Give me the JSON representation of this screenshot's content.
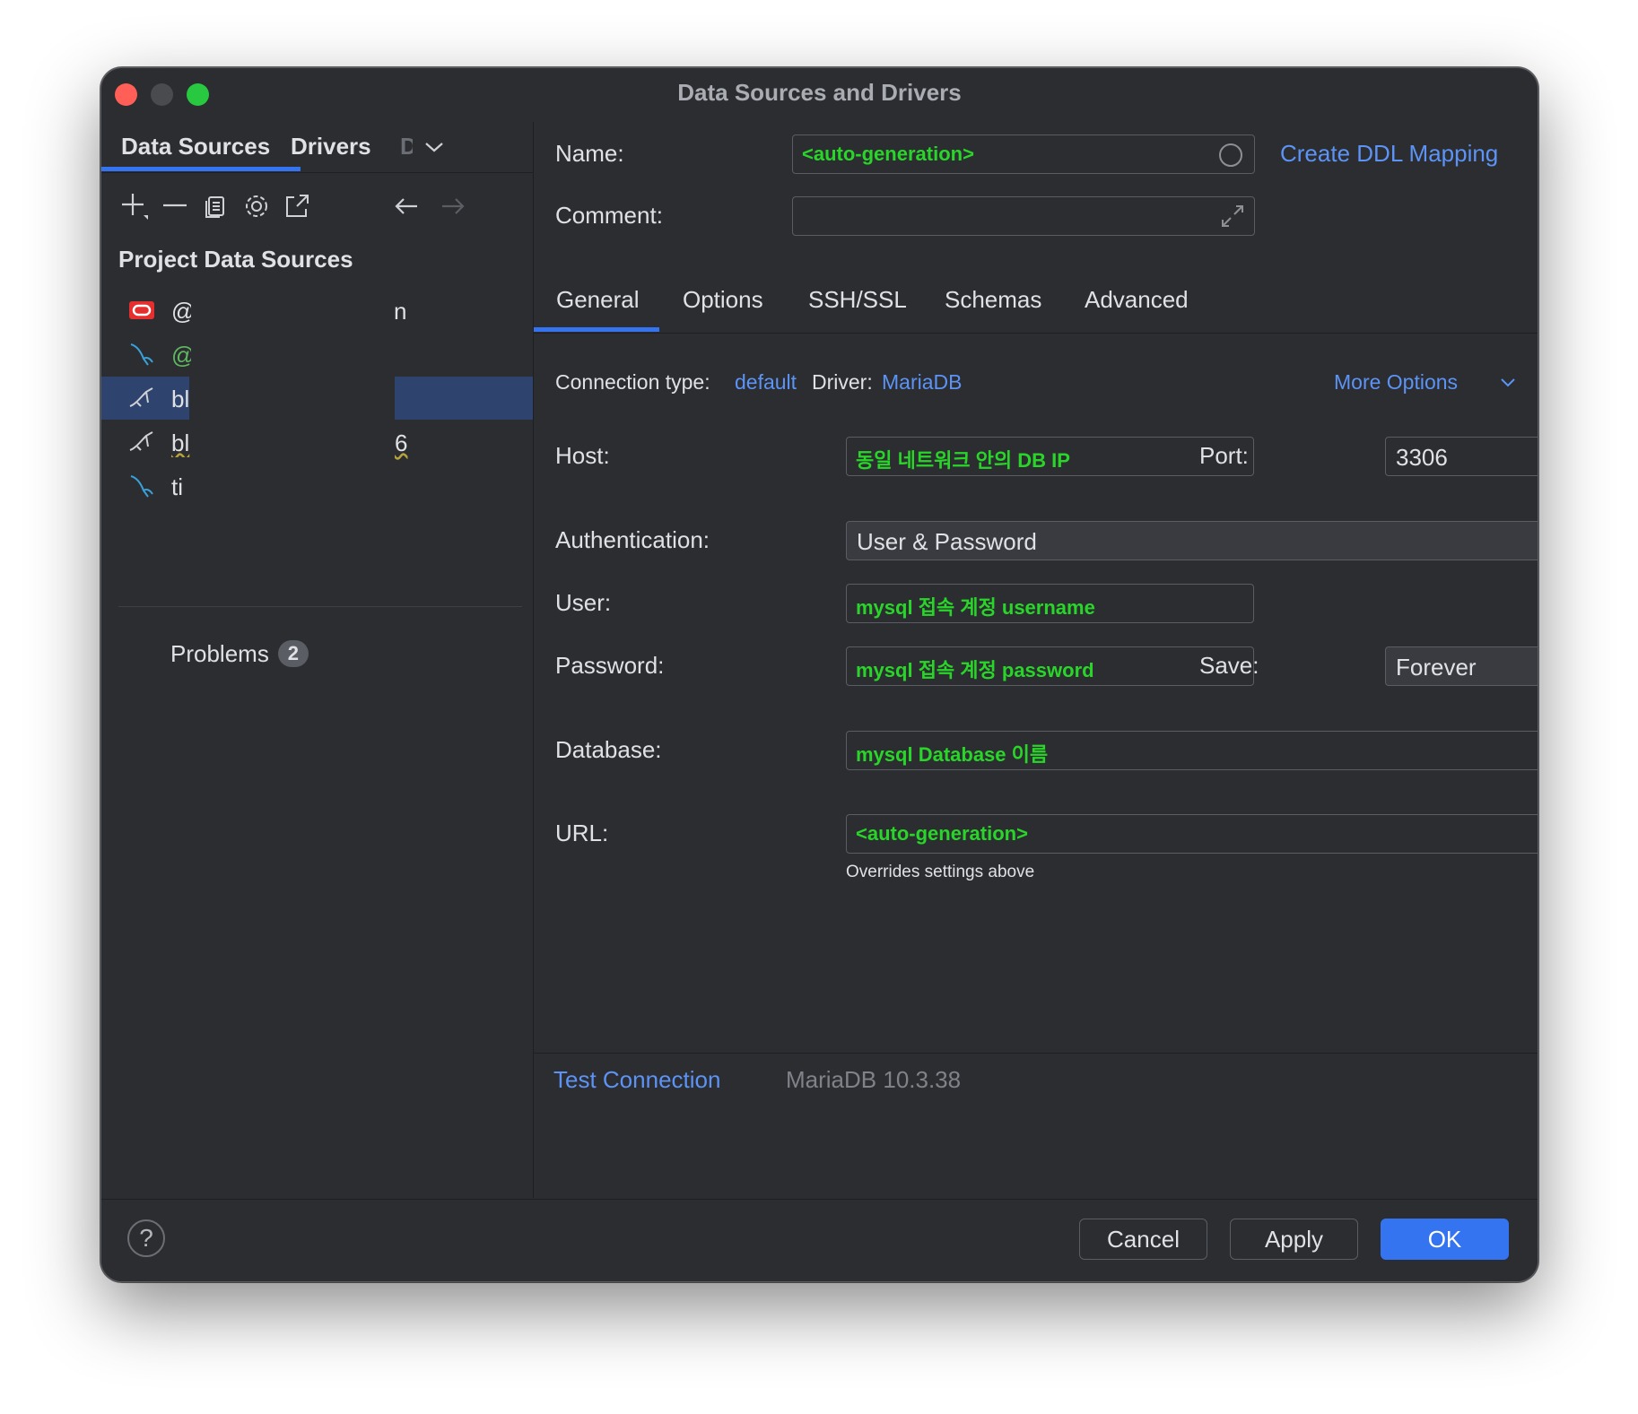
{
  "window": {
    "title": "Data Sources and Drivers"
  },
  "left": {
    "tabs": [
      "Data Sources",
      "Drivers",
      "D"
    ],
    "section_title": "Project Data Sources",
    "items": [
      {
        "icon": "oracle-icon",
        "name": "@",
        "tail": "n"
      },
      {
        "icon": "mysql-icon",
        "name": "@",
        "tail": ""
      },
      {
        "icon": "mariadb-icon",
        "name": "bl",
        "tail": "",
        "selected": true
      },
      {
        "icon": "mariadb-icon",
        "name": "bl",
        "tail": "6"
      },
      {
        "icon": "mysql-icon",
        "name": "ti",
        "tail": ""
      }
    ],
    "problems_label": "Problems",
    "problems_count": "2"
  },
  "form": {
    "name_label": "Name:",
    "name_value": "<auto-generation>",
    "create_ddl": "Create DDL Mapping",
    "comment_label": "Comment:",
    "tabs": [
      "General",
      "Options",
      "SSH/SSL",
      "Schemas",
      "Advanced"
    ],
    "connection_type_label": "Connection type:",
    "connection_type_value": "default",
    "driver_label": "Driver:",
    "driver_value": "MariaDB",
    "more_options": "More Options",
    "host_label": "Host:",
    "host_value": "동일 네트워크 안의 DB IP",
    "port_label": "Port:",
    "port_value": "3306",
    "auth_label": "Authentication:",
    "auth_value": "User & Password",
    "user_label": "User:",
    "user_value": "mysql 접속 계정 username",
    "password_label": "Password:",
    "password_value": "mysql 접속 계정 password",
    "save_label": "Save:",
    "save_value": "Forever",
    "database_label": "Database:",
    "database_value": "mysql Database 이름",
    "url_label": "URL:",
    "url_value": "<auto-generation>",
    "url_note": "Overrides settings above",
    "test_connection": "Test Connection",
    "driver_version": "MariaDB 10.3.38"
  },
  "footer": {
    "help": "?",
    "cancel": "Cancel",
    "apply": "Apply",
    "ok": "OK"
  },
  "colors": {
    "background": "#2b2d30",
    "accent": "#3574f0",
    "link": "#5c93f5",
    "annotation_green": "#2ad52a",
    "selection": "#2e436e"
  }
}
